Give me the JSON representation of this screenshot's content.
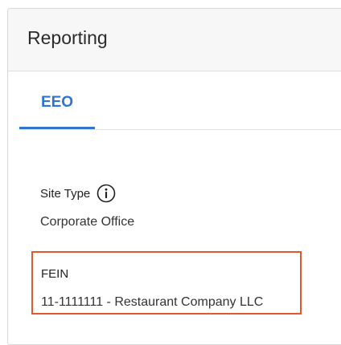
{
  "panel": {
    "title": "Reporting"
  },
  "tabs": [
    {
      "label": "EEO",
      "active": true
    }
  ],
  "fields": {
    "site_type": {
      "label": "Site Type",
      "value": "Corporate Office",
      "icon": "info-icon"
    },
    "fein": {
      "label": "FEIN",
      "value": "11-1111111 - Restaurant Company LLC"
    }
  },
  "colors": {
    "accent": "#2f74cf",
    "highlight_border": "#e2592e",
    "header_bg": "#f7f7f7"
  }
}
